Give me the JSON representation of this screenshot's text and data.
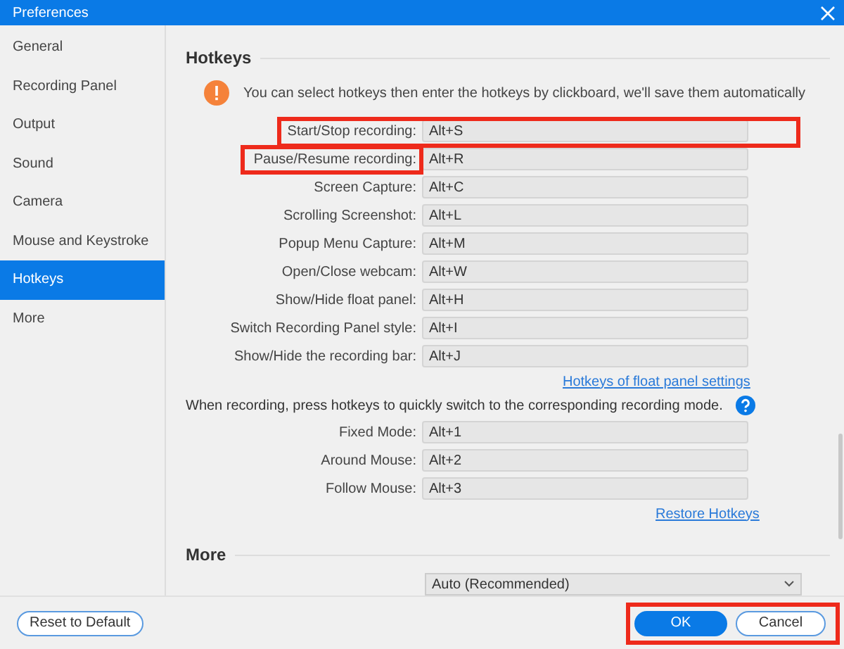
{
  "window": {
    "title": "Preferences"
  },
  "sidebar": {
    "items": [
      {
        "label": "General",
        "selected": false
      },
      {
        "label": "Recording Panel",
        "selected": false
      },
      {
        "label": "Output",
        "selected": false
      },
      {
        "label": "Sound",
        "selected": false
      },
      {
        "label": "Camera",
        "selected": false
      },
      {
        "label": "Mouse and Keystroke",
        "selected": false
      },
      {
        "label": "Hotkeys",
        "selected": true
      },
      {
        "label": "More",
        "selected": false
      }
    ]
  },
  "hotkeys": {
    "heading": "Hotkeys",
    "notice": "You can select hotkeys then enter the hotkeys by clickboard, we'll save them automatically",
    "rows": [
      {
        "label": "Start/Stop recording:",
        "value": "Alt+S",
        "row_highlighted": true,
        "label_highlighted": false
      },
      {
        "label": "Pause/Resume recording:",
        "value": "Alt+R",
        "row_highlighted": false,
        "label_highlighted": true
      },
      {
        "label": "Screen Capture:",
        "value": "Alt+C",
        "row_highlighted": false,
        "label_highlighted": false
      },
      {
        "label": "Scrolling Screenshot:",
        "value": "Alt+L",
        "row_highlighted": false,
        "label_highlighted": false
      },
      {
        "label": "Popup Menu Capture:",
        "value": "Alt+M",
        "row_highlighted": false,
        "label_highlighted": false
      },
      {
        "label": "Open/Close webcam:",
        "value": "Alt+W",
        "row_highlighted": false,
        "label_highlighted": false
      },
      {
        "label": "Show/Hide float panel:",
        "value": "Alt+H",
        "row_highlighted": false,
        "label_highlighted": false
      },
      {
        "label": "Switch Recording Panel style:",
        "value": "Alt+I",
        "row_highlighted": false,
        "label_highlighted": false
      },
      {
        "label": "Show/Hide the recording bar:",
        "value": "Alt+J",
        "row_highlighted": false,
        "label_highlighted": false
      }
    ],
    "float_link": "Hotkeys of float panel settings",
    "mode_note": "When recording, press hotkeys to quickly switch to the corresponding recording mode.",
    "mode_rows": [
      {
        "label": "Fixed Mode:",
        "value": "Alt+1"
      },
      {
        "label": "Around Mouse:",
        "value": "Alt+2"
      },
      {
        "label": "Follow Mouse:",
        "value": "Alt+3"
      }
    ],
    "restore_link": "Restore Hotkeys"
  },
  "more": {
    "heading": "More",
    "dropdown_value": "Auto (Recommended)"
  },
  "footer": {
    "reset": "Reset to Default",
    "ok": "OK",
    "cancel": "Cancel",
    "highlighted": true
  }
}
